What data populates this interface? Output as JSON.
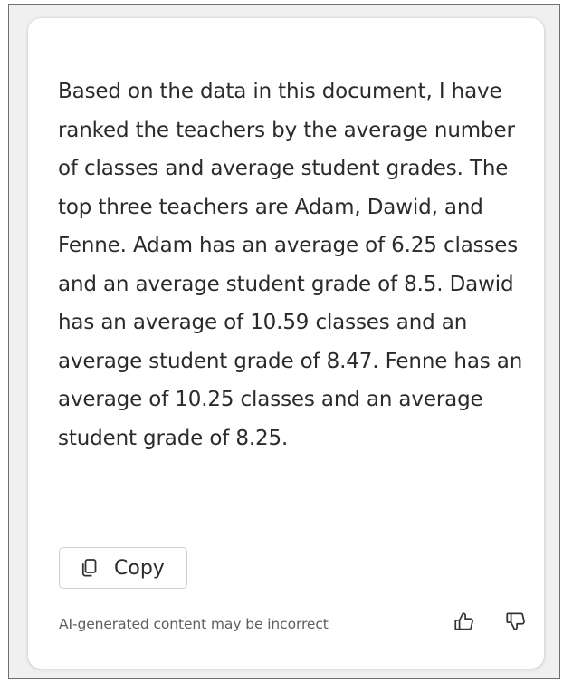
{
  "response": {
    "text": "Based on the data in this document, I have ranked the teachers by the average number of classes and average student grades. The top three teachers are Adam, Dawid, and Fenne. Adam has an average of 6.25 classes and an average student grade of 8.5. Dawid has an average of 10.59 classes and an average student grade of 8.47. Fenne has an average of 10.25 classes and an average student grade of 8.25."
  },
  "actions": {
    "copy_label": "Copy",
    "copy_icon": "copy-icon",
    "thumbs_up_icon": "thumbs-up-icon",
    "thumbs_down_icon": "thumbs-down-icon"
  },
  "footer": {
    "disclaimer": "AI-generated content may be incorrect"
  },
  "colors": {
    "text": "#2b2b2b",
    "muted": "#5e5e5e",
    "card_background": "#ffffff",
    "frame_background": "#f0f0f0",
    "button_border": "#cfcfcf"
  }
}
